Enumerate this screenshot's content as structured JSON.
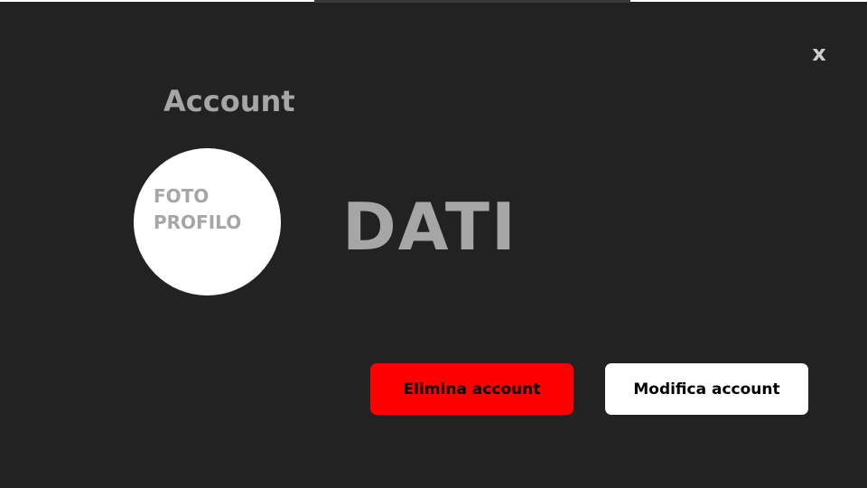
{
  "dialog": {
    "title": "Account",
    "close_label": "x"
  },
  "profile": {
    "photo_line1": "FOTO",
    "photo_line2": "PROFILO"
  },
  "data_placeholder": "DATI",
  "actions": {
    "delete_label": "Elimina account",
    "edit_label": "Modifica account"
  },
  "colors": {
    "background": "#222222",
    "text_muted": "#a6a6a6",
    "danger": "#ff0000",
    "surface": "#ffffff"
  }
}
